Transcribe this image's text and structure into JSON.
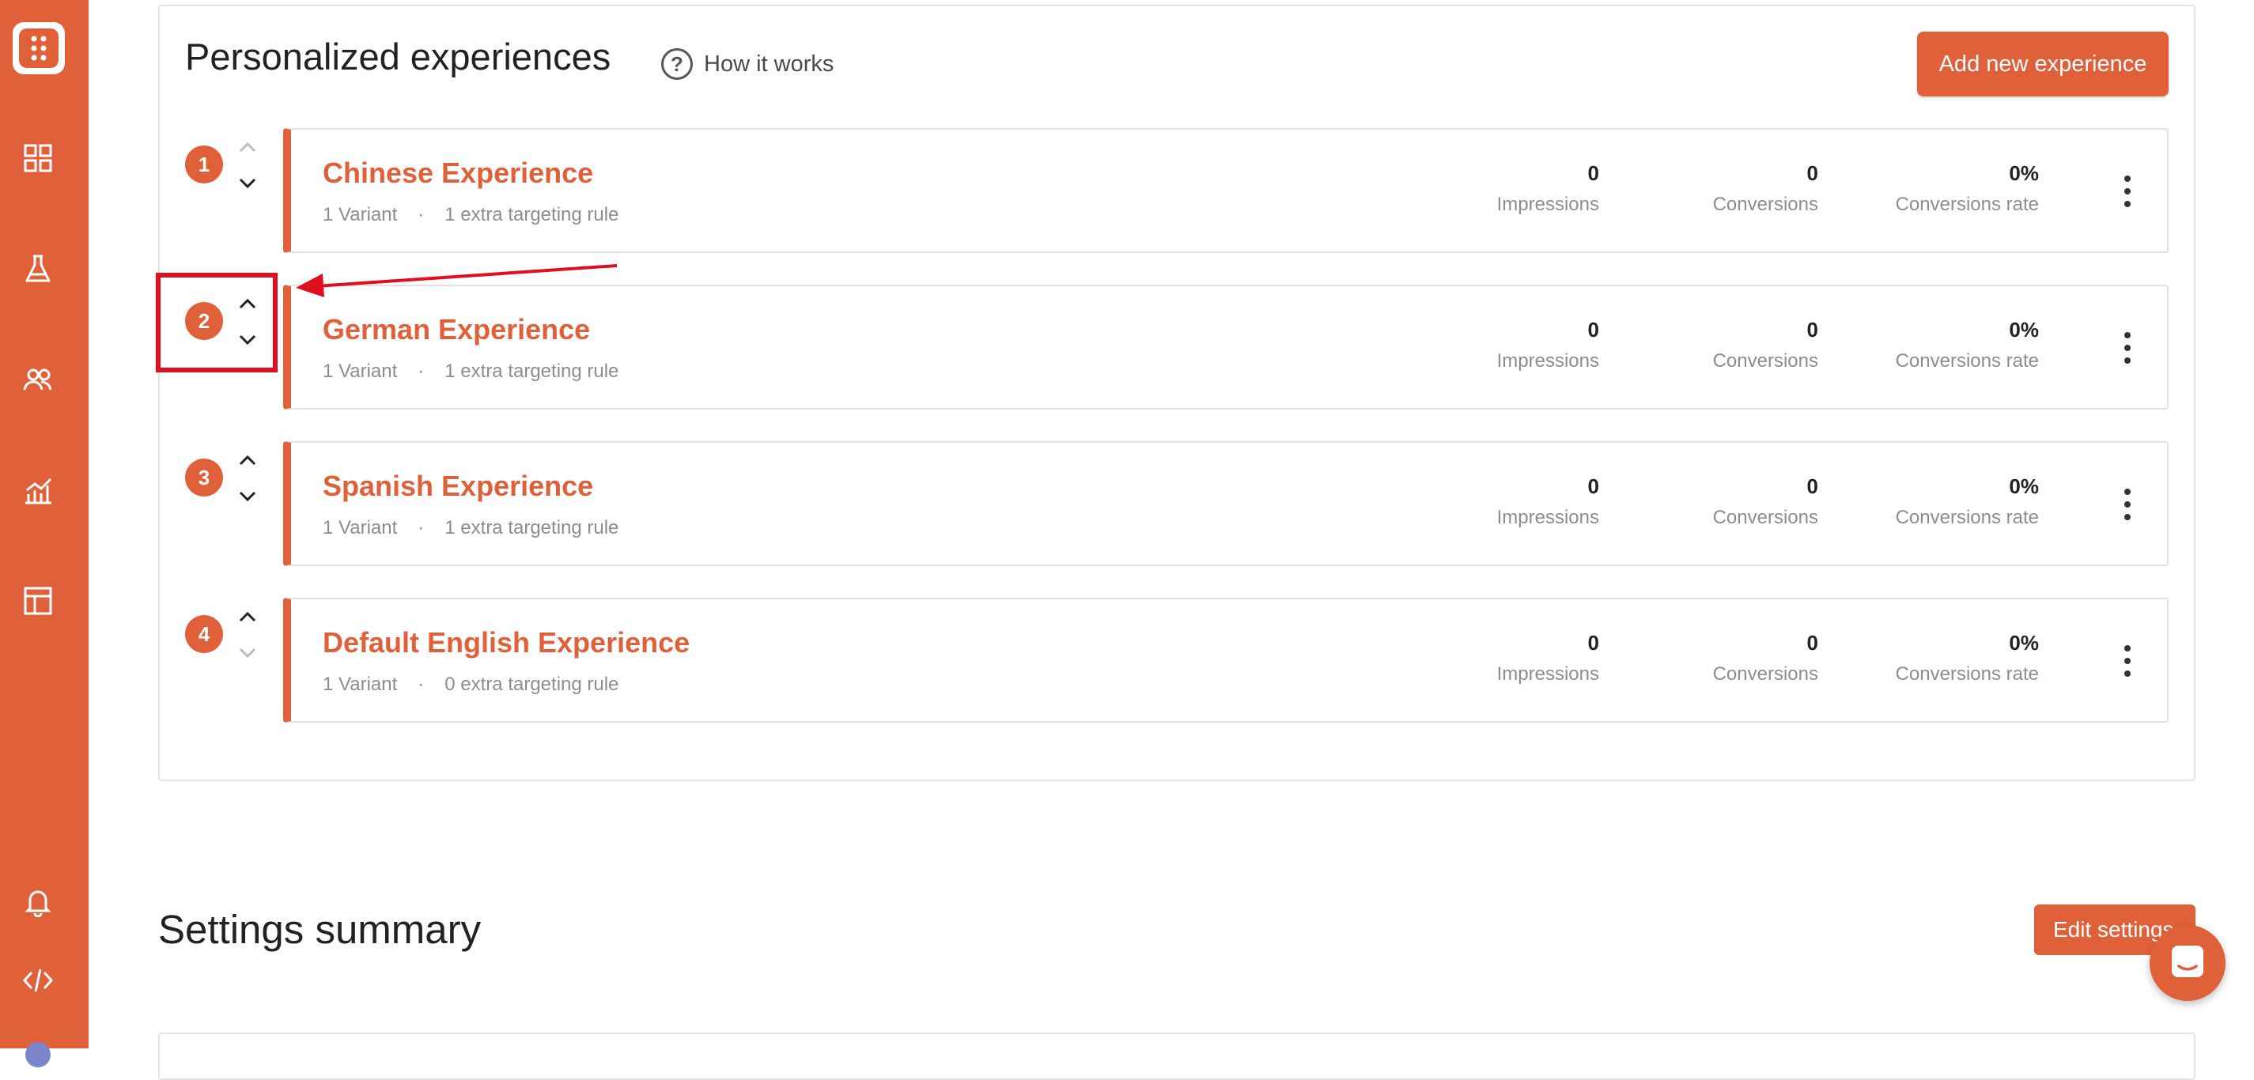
{
  "sidebar": {
    "logo": "app-logo-icon",
    "items": [
      "dashboard-icon",
      "flask-icon",
      "users-icon",
      "analytics-icon",
      "layout-icon"
    ],
    "bottom_items": [
      "bell-icon",
      "code-icon"
    ]
  },
  "section": {
    "title": "Personalized experiences",
    "how_it_works": "How it works",
    "how_it_works_icon": "?",
    "add_button": "Add new experience"
  },
  "experiences": [
    {
      "rank": "1",
      "name": "Chinese Experience",
      "variants": "1 Variant",
      "sep": "·",
      "rules": "1 extra targeting rule",
      "impressions": "0",
      "conversions": "0",
      "rate": "0%"
    },
    {
      "rank": "2",
      "name": "German Experience",
      "variants": "1 Variant",
      "sep": "·",
      "rules": "1 extra targeting rule",
      "impressions": "0",
      "conversions": "0",
      "rate": "0%"
    },
    {
      "rank": "3",
      "name": "Spanish Experience",
      "variants": "1 Variant",
      "sep": "·",
      "rules": "1 extra targeting rule",
      "impressions": "0",
      "conversions": "0",
      "rate": "0%"
    },
    {
      "rank": "4",
      "name": "Default English Experience",
      "variants": "1 Variant",
      "sep": "·",
      "rules": "0 extra targeting rule",
      "impressions": "0",
      "conversions": "0",
      "rate": "0%"
    }
  ],
  "labels": {
    "impressions": "Impressions",
    "conversions": "Conversions",
    "rate": "Conversions rate"
  },
  "settings": {
    "title": "Settings summary",
    "edit_button": "Edit settings"
  },
  "colors": {
    "accent": "#e06139",
    "annotation": "#e10e1e"
  }
}
